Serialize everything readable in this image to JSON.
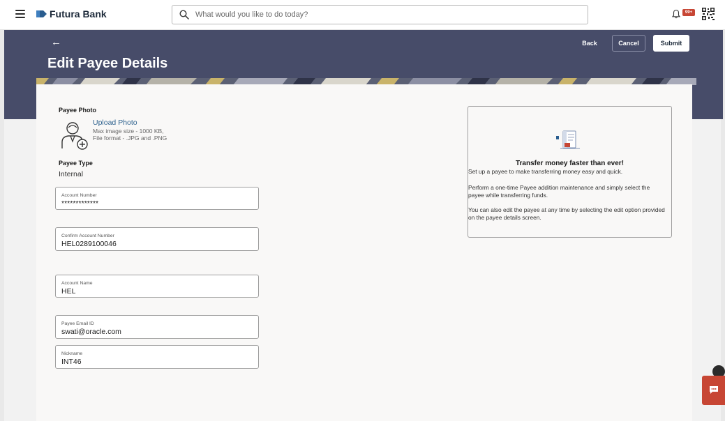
{
  "app": {
    "brand": "Futura Bank",
    "search_placeholder": "What would you like to do today?",
    "notification_badge": "99+"
  },
  "page": {
    "title": "Edit Payee Details",
    "actions": {
      "back": "Back",
      "cancel": "Cancel",
      "submit": "Submit"
    }
  },
  "form": {
    "payee_photo_label": "Payee Photo",
    "upload_label": "Upload Photo",
    "upload_hint_size": "Max image size - 1000 KB,",
    "upload_hint_format": "File format - .JPG and .PNG",
    "payee_type_label": "Payee Type",
    "payee_type_value": "Internal",
    "fields": [
      {
        "label": "Account Number",
        "value": "*************"
      },
      {
        "label": "Confirm Account Number",
        "value": "HEL0289100046"
      },
      {
        "label": "Account Name",
        "value": "HEL"
      },
      {
        "label": "Payee Email ID",
        "value": "swati@oracle.com"
      },
      {
        "label": "Nickname",
        "value": "INT46"
      }
    ]
  },
  "info": {
    "title": "Transfer money faster than ever!",
    "p1": "Set up a payee to make transferring money easy and quick.",
    "p2": "Perform a one-time Payee addition maintenance and simply select the payee while transferring funds.",
    "p3": "You can also edit the payee at any time by selecting the edit option provided on the payee details screen."
  },
  "colors": {
    "header_band": "#474c69",
    "accent_red": "#c74634",
    "link_blue": "#316490"
  },
  "icons": {
    "menu": "hamburger-icon",
    "search": "search-icon",
    "bell": "bell-icon",
    "qr": "qr-code-icon",
    "back": "back-arrow-icon",
    "upload": "user-add-photo-icon",
    "chat": "chat-icon"
  }
}
